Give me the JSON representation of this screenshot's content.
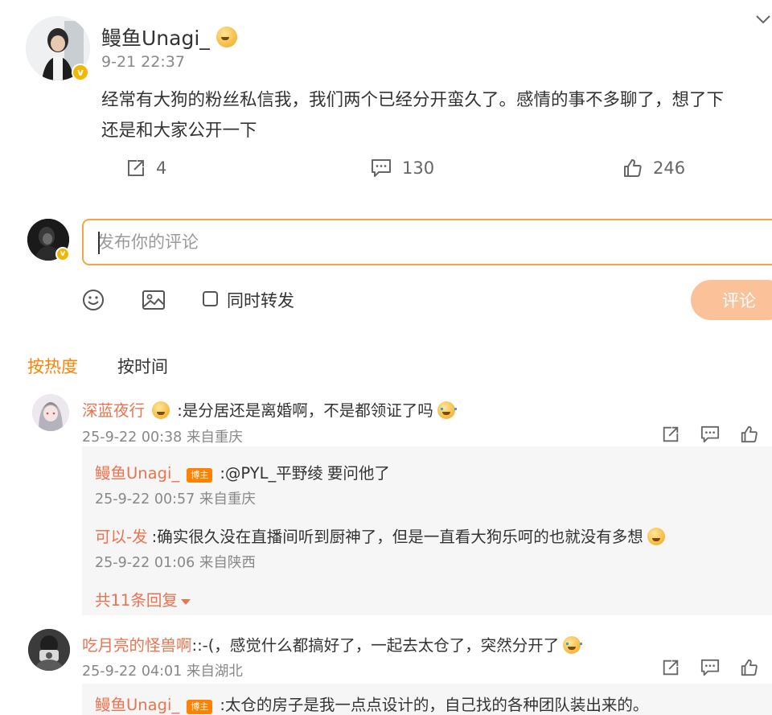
{
  "post": {
    "author": "鳗鱼Unagi_",
    "time": "9-21 22:37",
    "content_line1": "经常有大狗的粉丝私信我，我们两个已经分开蛮久了。感情的事不多聊了，想了下",
    "content_line2": "还是和大家公开一下",
    "reposts": "4",
    "comments": "130",
    "likes": "246"
  },
  "composer": {
    "placeholder": "发布你的评论",
    "also_repost_label": "同时转发",
    "submit_label": "评论"
  },
  "sort_tabs": {
    "hot": "按热度",
    "time": "按时间"
  },
  "comments": [
    {
      "name": "深蓝夜行",
      "text": ":是分居还是离婚啊，不是都领证了吗",
      "time": "25-9-22 00:38 来自重庆",
      "replies": [
        {
          "name": "鳗鱼Unagi_",
          "tag": "博主",
          "mention": ":@PYL_平野绫",
          "text": " 要问他了",
          "time": "25-9-22 00:57 来自重庆"
        },
        {
          "name": "可以-发",
          "text": ":确实很久没在直播间听到厨神了，但是一直看大狗乐呵的也就没有多想",
          "time": "25-9-22 01:06 来自陕西"
        }
      ],
      "more_replies": "共11条回复"
    },
    {
      "name": "吃月亮的怪兽啊",
      "text": "::-(，感觉什么都搞好了，一起去太仓了，突然分开了",
      "time": "25-9-22 04:01 来自湖北",
      "replies": [
        {
          "name": "鳗鱼Unagi_",
          "tag": "博主",
          "text": ":太仓的房子是我一点点设计的，自己找的各种团队装出来的。"
        }
      ]
    }
  ],
  "colors": {
    "accent": "#ff8200",
    "name_orange": "#eb7350",
    "input_border": "#f5a446",
    "submit_bg": "#fbc29a"
  }
}
